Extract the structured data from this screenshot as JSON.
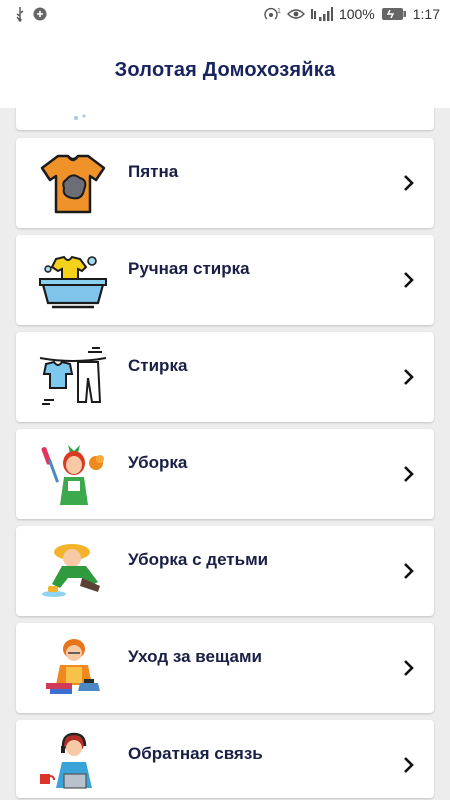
{
  "status": {
    "battery": "100%",
    "time": "1:17"
  },
  "app": {
    "title": "Золотая Домохозяйка"
  },
  "items": [
    {
      "label": "Пятна",
      "icon": "stained-shirt-icon"
    },
    {
      "label": "Ручная стирка",
      "icon": "hand-wash-basin-icon"
    },
    {
      "label": "Стирка",
      "icon": "clothesline-icon"
    },
    {
      "label": "Уборка",
      "icon": "cleaning-woman-icon"
    },
    {
      "label": "Уборка с детьми",
      "icon": "child-cleaning-floor-icon"
    },
    {
      "label": "Уход за вещами",
      "icon": "woman-ironing-icon"
    },
    {
      "label": "Обратная связь",
      "icon": "support-operator-icon"
    }
  ],
  "colors": {
    "title": "#19245e",
    "label": "#1a1f45",
    "background": "#ededed"
  }
}
